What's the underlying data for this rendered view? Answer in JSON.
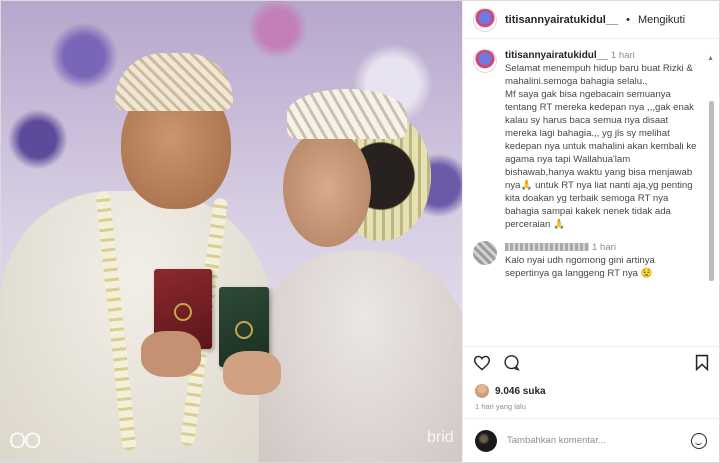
{
  "photo": {
    "watermark_left": "OO",
    "watermark_right": "brid"
  },
  "header": {
    "username": "titisannyairatukidul__",
    "separator": "•",
    "follow_status": "Mengikuti"
  },
  "comments": [
    {
      "username": "titisannyairatukidul__",
      "time": "1 hari",
      "text": "Selamat menempuh hidup baru buat Rizki & mahalini.semoga bahagia selalu.,\nMf saya gak bisa ngebacain semuanya tentang RT mereka kedepan nya ,,,gak enak kalau sy harus baca semua nya disaat mereka lagi bahagia.,, yg jls sy melihat kedepan nya untuk mahalini akan kembali ke agama nya tapi Wallahua'lam bishawab,hanya waktu yang bisa menjawab nya🙏 untuk RT nya liat nanti aja,yg penting kita doakan yg terbaik semoga RT nya bahagia sampai kakek nenek tidak ada perceraian 🙏"
    },
    {
      "username": "",
      "time": "1 hari",
      "text": "Kalo nyai udh ngomong gini artinya sepertinya ga langgeng RT nya 😟"
    }
  ],
  "actions": {
    "like_icon": "heart-icon",
    "comment_icon": "comment-icon",
    "bookmark_icon": "bookmark-icon"
  },
  "likes": {
    "count_label": "9.046 suka"
  },
  "time_ago": "1 hari yang lalu",
  "add_comment": {
    "placeholder": "Tambahkan komentar..."
  },
  "colors": {
    "text": "#262626",
    "muted": "#8e8e8e",
    "border": "#dbdbdb"
  }
}
